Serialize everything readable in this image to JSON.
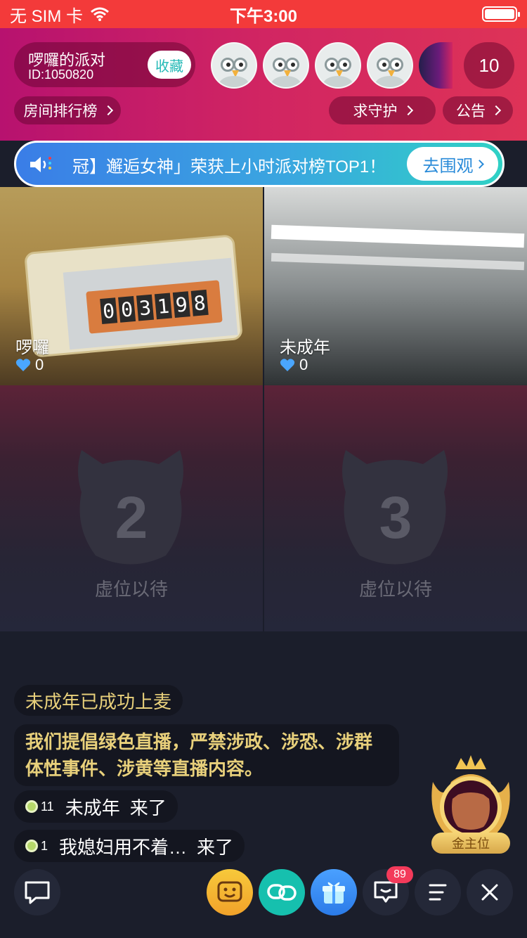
{
  "status_bar": {
    "carrier": "无 SIM 卡",
    "time": "下午3:00",
    "wifi_icon": "wifi-icon",
    "battery_icon": "battery-icon"
  },
  "room": {
    "name": "啰囉的派对",
    "id": "ID:1050820",
    "favorite_label": "收藏",
    "online_count": "10",
    "ranking_label": "房间排行榜",
    "guard_label": "求守护",
    "announcement_label": "公告"
  },
  "notice": {
    "text": "冠】邂逅女神」荣获上小时派对榜TOP1！",
    "button_label": "去围观"
  },
  "video_tiles": [
    {
      "name": "啰囉",
      "likes": "0"
    },
    {
      "name": "未成年",
      "likes": "0"
    }
  ],
  "timer_digits": [
    "0",
    "0",
    "3",
    "1",
    "9",
    "8"
  ],
  "seats": [
    {
      "number": "2",
      "label": "虚位以待"
    },
    {
      "number": "3",
      "label": "虚位以待"
    }
  ],
  "chat": {
    "system_join": "未成年已成功上麦",
    "rules": "我们提倡绿色直播，严禁涉政、涉恐、涉群体性事件、涉黄等直播内容。",
    "messages": [
      {
        "level": "11",
        "user": "未成年",
        "text": "来了"
      },
      {
        "level": "1",
        "user": "我媳妇用不着…",
        "text": "来了"
      }
    ]
  },
  "throne": {
    "label": "金主位"
  },
  "bottom_bar": {
    "message_badge": "89"
  },
  "colors": {
    "status_bar": "#f33a3a",
    "header_start": "#b7126f",
    "header_end": "#de3357",
    "accent_teal": "#23b9b6",
    "chat_gold": "#e8d07b",
    "background": "#1b1e2b"
  }
}
